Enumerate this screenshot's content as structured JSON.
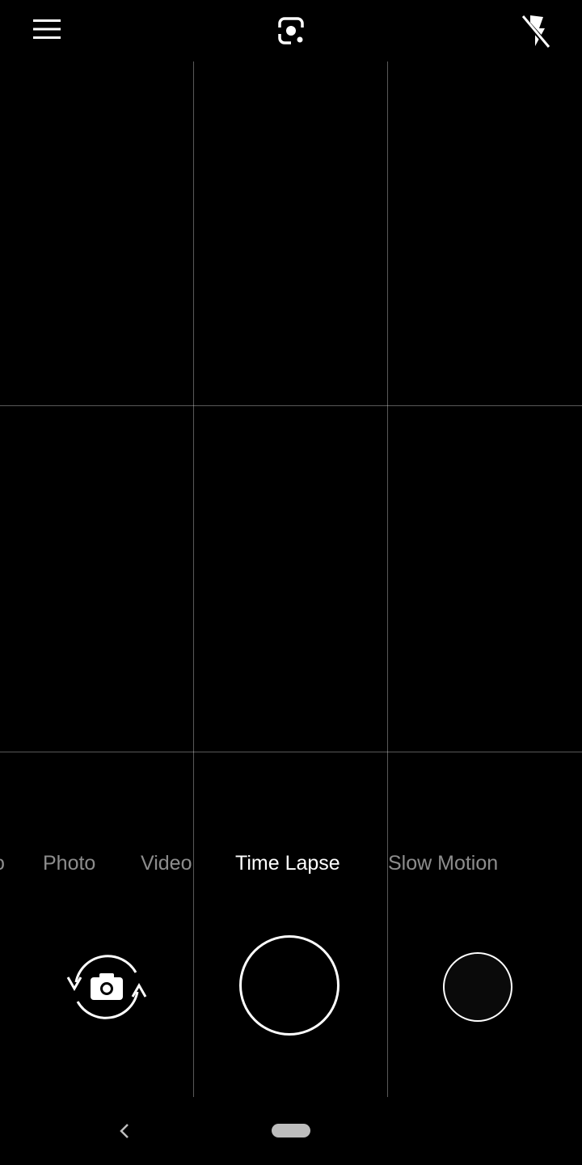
{
  "top_bar": {
    "menu_icon": "menu-icon",
    "lens_icon": "google-lens-icon",
    "flash_icon": "flash-off-icon"
  },
  "modes": {
    "items": [
      {
        "label": "o",
        "active": false
      },
      {
        "label": "Photo",
        "active": false
      },
      {
        "label": "Video",
        "active": false
      },
      {
        "label": "Time Lapse",
        "active": true
      },
      {
        "label": "Slow Motion",
        "active": false
      }
    ]
  },
  "controls": {
    "switch_camera_icon": "switch-camera-icon",
    "shutter": "shutter-button",
    "gallery": "gallery-thumbnail"
  },
  "nav": {
    "back_icon": "back-icon",
    "home_icon": "home-pill-icon"
  },
  "colors": {
    "background": "#000000",
    "foreground": "#ffffff",
    "inactive_mode": "#8c8c8c",
    "grid": "#595959"
  }
}
